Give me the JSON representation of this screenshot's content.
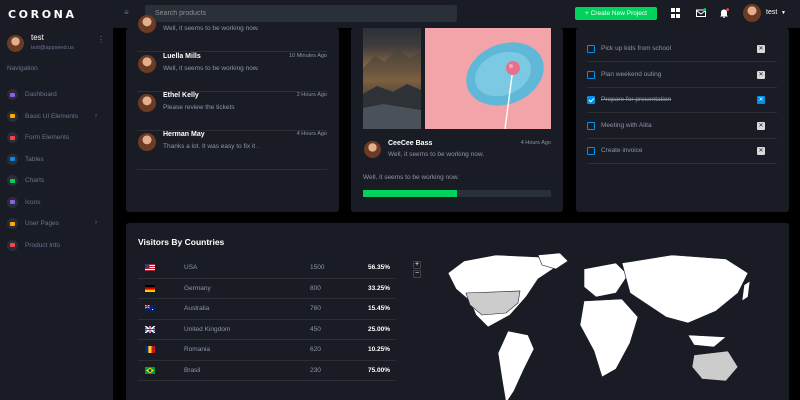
{
  "brand": {
    "name": "CORONA"
  },
  "sidebar": {
    "profile": {
      "name": "test",
      "email": "test@appseed.us"
    },
    "nav_title": "Navigation",
    "items": [
      {
        "label": "Dashboard",
        "icon": "speedometer-icon",
        "color": "#8f5fe8",
        "has_arrow": false
      },
      {
        "label": "Basic UI Elements",
        "icon": "laptop-icon",
        "color": "#ffab00",
        "has_arrow": true
      },
      {
        "label": "Form Elements",
        "icon": "playlist-icon",
        "color": "#fc424a",
        "has_arrow": false
      },
      {
        "label": "Tables",
        "icon": "table-icon",
        "color": "#0090e7",
        "has_arrow": false
      },
      {
        "label": "Charts",
        "icon": "chart-icon",
        "color": "#00d25b",
        "has_arrow": false
      },
      {
        "label": "Icons",
        "icon": "contacts-icon",
        "color": "#8f5fe8",
        "has_arrow": false
      },
      {
        "label": "User Pages",
        "icon": "security-icon",
        "color": "#ffab00",
        "has_arrow": true
      },
      {
        "label": "Product Info",
        "icon": "file-icon",
        "color": "#fc424a",
        "has_arrow": false
      }
    ]
  },
  "navbar": {
    "search_placeholder": "Search products",
    "create_label": "+ Create New Project",
    "user": "test"
  },
  "messages": [
    {
      "name": "",
      "text": "Well, it seems to be working now.",
      "time": ""
    },
    {
      "name": "Luella Mills",
      "text": "Well, it seems to be working now.",
      "time": "10 Minutes Ago"
    },
    {
      "name": "Ethel Kelly",
      "text": "Please review the tickets",
      "time": "2 Hours Ago"
    },
    {
      "name": "Herman May",
      "text": "Thanks a lot. It was easy to fix it .",
      "time": "4 Hours Ago"
    }
  ],
  "photo_card": {
    "name": "CeeCee Bass",
    "text": "Well, it seems to be working now.",
    "time": "4 Hours Ago",
    "status": "Well, it seems to be working now.",
    "progress": 0.5
  },
  "todos": [
    {
      "label": "Pick up kids from school",
      "done": false
    },
    {
      "label": "Plan weekend outing",
      "done": false
    },
    {
      "label": "Prepare for presentation",
      "done": true
    },
    {
      "label": "Meeting with Alita",
      "done": false
    },
    {
      "label": "Create invoice",
      "done": false
    }
  ],
  "visitors": {
    "title": "Visitors By Countries",
    "rows": [
      {
        "flag": "us-flag",
        "country": "USA",
        "count": "1500",
        "pct": "56.35%"
      },
      {
        "flag": "de-flag",
        "country": "Germany",
        "count": "800",
        "pct": "33.25%"
      },
      {
        "flag": "au-flag",
        "country": "Australia",
        "count": "760",
        "pct": "15.45%"
      },
      {
        "flag": "gb-flag",
        "country": "United Kingdom",
        "count": "450",
        "pct": "25.00%"
      },
      {
        "flag": "ro-flag",
        "country": "Romania",
        "count": "620",
        "pct": "10.25%"
      },
      {
        "flag": "br-flag",
        "country": "Brasil",
        "count": "230",
        "pct": "75.00%"
      }
    ],
    "zoom_in": "+",
    "zoom_out": "−"
  }
}
